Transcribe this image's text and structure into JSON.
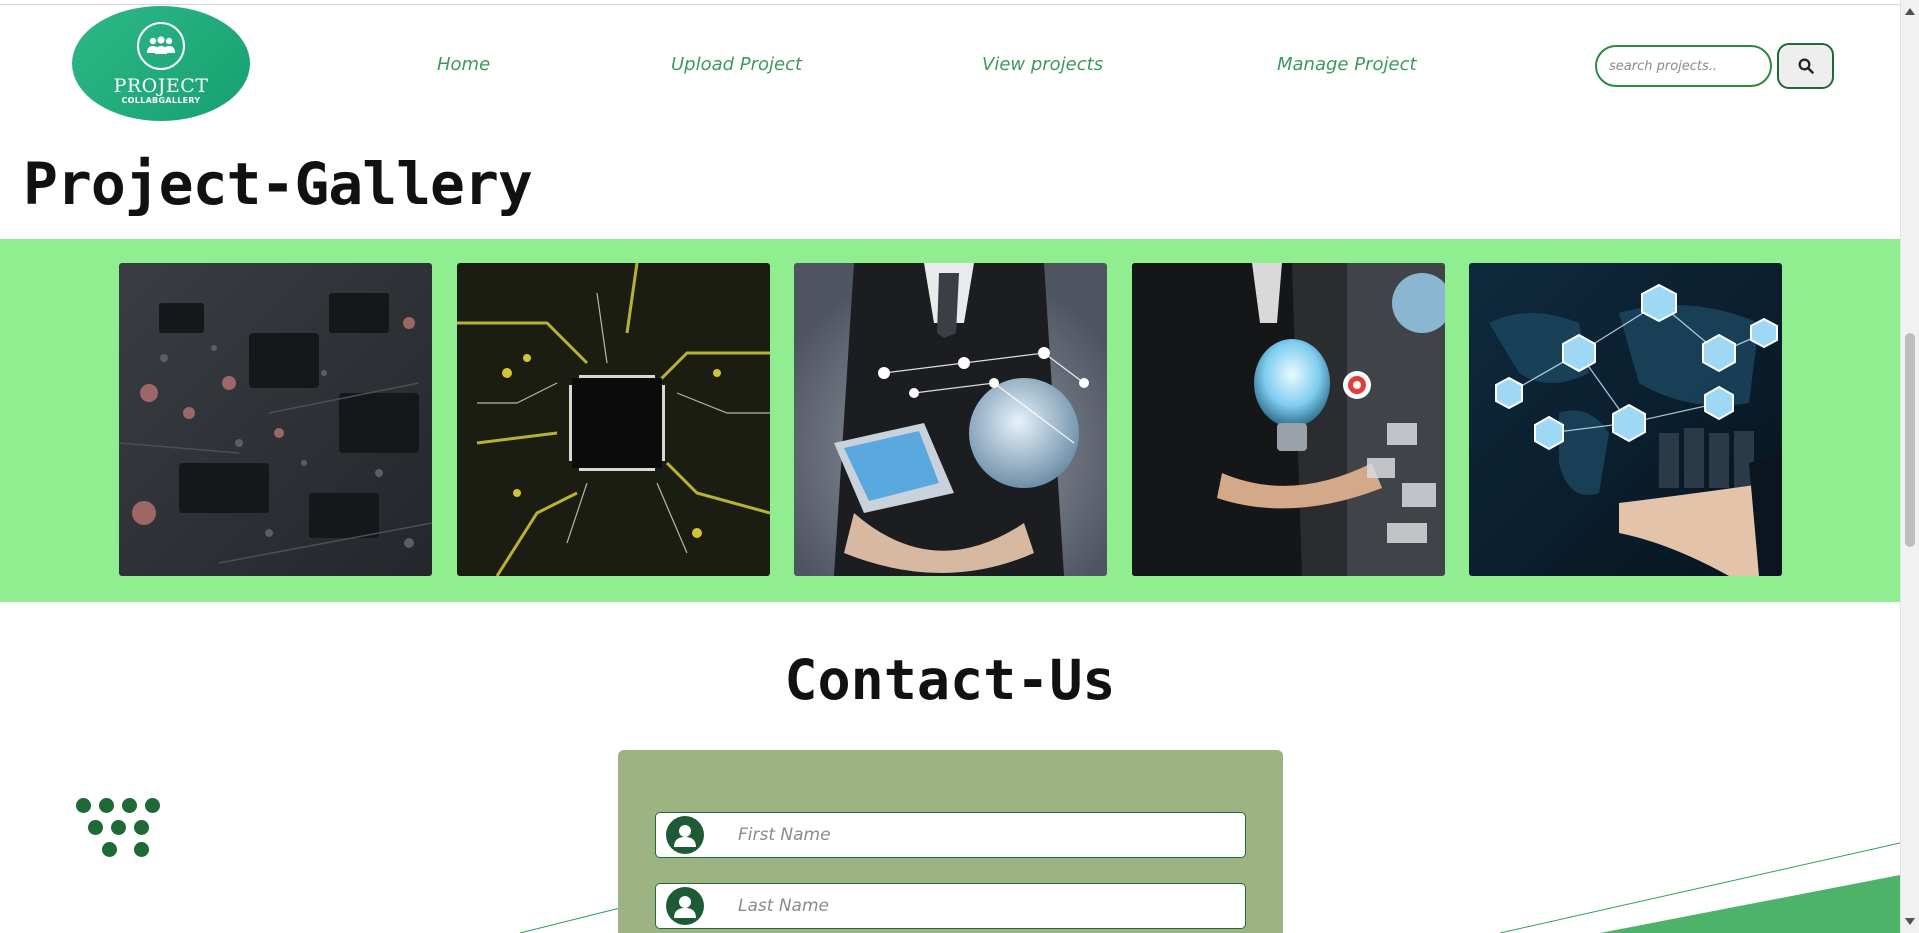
{
  "header": {
    "logo": {
      "title": "PROJECT",
      "subtitle": "COLLABGALLERY",
      "icon": "people-group-icon"
    },
    "nav": [
      {
        "label": "Home"
      },
      {
        "label": "Upload Project"
      },
      {
        "label": "View projects"
      },
      {
        "label": "Manage Project"
      }
    ],
    "search": {
      "placeholder": "search projects..",
      "button_icon": "search-icon"
    }
  },
  "gallery": {
    "heading": "Project-Gallery",
    "background": "#90ee90",
    "images": [
      {
        "subject": "circuit-board-closeup"
      },
      {
        "subject": "chip-on-circuit-board"
      },
      {
        "subject": "businessman-holding-laptop-globe"
      },
      {
        "subject": "businessman-holding-lightbulb"
      },
      {
        "subject": "hand-with-world-map-network"
      }
    ]
  },
  "contact": {
    "heading": "Contact-Us",
    "fields": [
      {
        "placeholder": "First Name",
        "icon": "user-icon"
      },
      {
        "placeholder": "Last Name",
        "icon": "user-icon"
      }
    ]
  },
  "colors": {
    "brand_green": "#2fb887",
    "nav_text": "#3e9a5c",
    "dark_green": "#1d6a36",
    "form_panel": "#9db384"
  }
}
